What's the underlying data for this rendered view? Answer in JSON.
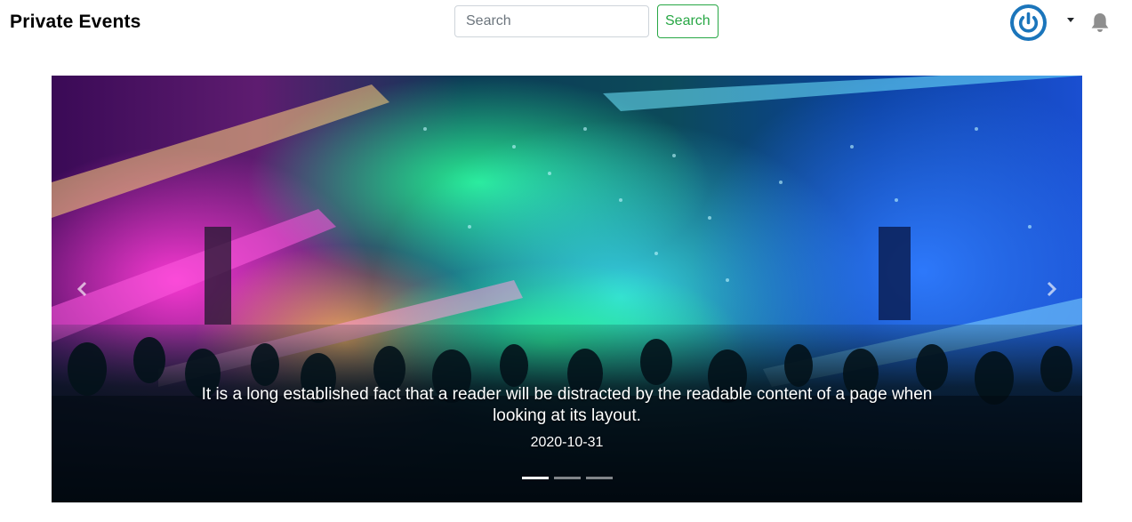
{
  "navbar": {
    "brand": "Private Events",
    "search": {
      "placeholder": "Search",
      "value": "",
      "button_label": "Search"
    },
    "avatar_icon": "power-icon",
    "dropdown_icon": "caret-down-icon",
    "notification_icon": "bell-icon"
  },
  "carousel": {
    "prev_icon": "chevron-left-icon",
    "next_icon": "chevron-right-icon",
    "slides": [
      {
        "caption": "It is a long established fact that a reader will be distracted by the readable content of a page when looking at its layout.",
        "date": "2020-10-31"
      }
    ],
    "active_index": 0,
    "indicator_count": 3
  },
  "colors": {
    "search_button": "#28a745",
    "avatar": "#1b75bb",
    "bell": "#8e8e8e"
  }
}
